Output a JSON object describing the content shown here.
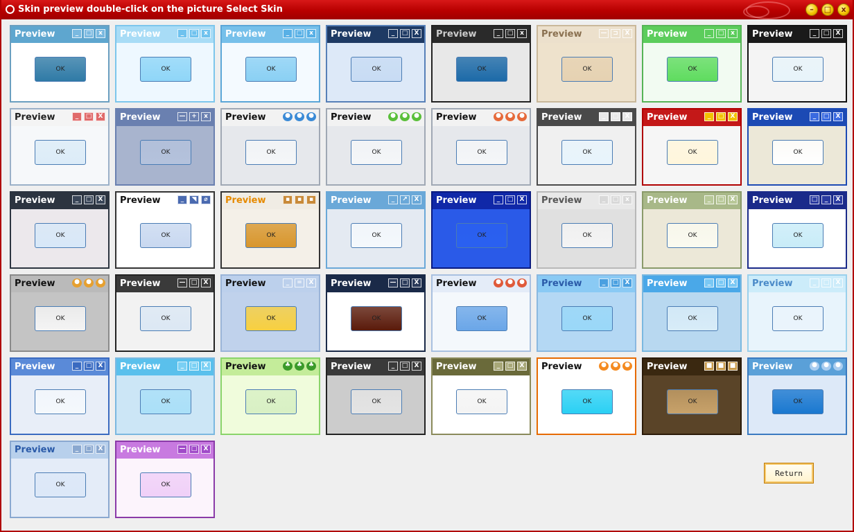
{
  "window": {
    "title": "Skin preview double-click on the picture Select Skin",
    "controls": [
      "minimize-icon",
      "maximize-icon",
      "close-icon"
    ],
    "accent": "#c00000"
  },
  "skins": [
    {
      "label": "Preview",
      "ok": "OK",
      "theme": {
        "bar": "#5ea6cf",
        "text": "#ffffff",
        "body": "#ffffff",
        "border": "#6a9fc0",
        "btn": "#2f7aa6",
        "ctl": "#7ab9e0",
        "ctls": [
          "_",
          "□",
          "x"
        ]
      }
    },
    {
      "label": "Preview",
      "ok": "OK",
      "theme": {
        "bar": "#a8dcf6",
        "text": "#ffffff",
        "body": "#eef8ff",
        "border": "#7cc6ec",
        "btn": "#8fd6f8",
        "ctl": "#6fc2ee",
        "ctls": [
          "_",
          "□",
          "x"
        ]
      }
    },
    {
      "label": "Preview",
      "ok": "OK",
      "theme": {
        "bar": "#76c0ea",
        "text": "#ffffff",
        "body": "#f4faff",
        "border": "#5aa6d8",
        "btn": "#8ad0f4",
        "ctl": "#58b0e6",
        "ctls": [
          "_",
          "□",
          "x"
        ]
      }
    },
    {
      "label": "Preview",
      "ok": "OK",
      "theme": {
        "bar": "#1e3a64",
        "text": "#ffffff",
        "body": "#dde9f8",
        "border": "#5780b8",
        "btn": "#c8dcf4",
        "ctl": "#1e3a64",
        "ctls": [
          "_",
          "□",
          "X"
        ]
      }
    },
    {
      "label": "Preview",
      "ok": "OK",
      "theme": {
        "bar": "#2a2a2a",
        "text": "#cccccc",
        "body": "#e8e8e8",
        "border": "#222222",
        "btn": "#1c6aa8",
        "ctl": "#2a2a2a",
        "ctls": [
          "_",
          "□",
          "x"
        ]
      }
    },
    {
      "label": "Preview",
      "ok": "OK",
      "theme": {
        "bar": "#ece0cc",
        "text": "#8a7050",
        "body": "#eee2cc",
        "border": "#c9b89a",
        "btn": "#e6d2b2",
        "ctl": "#ece0cc",
        "ctls": [
          "—",
          "⊐",
          "X"
        ]
      }
    },
    {
      "label": "Preview",
      "ok": "OK",
      "theme": {
        "bar": "#5ccd5c",
        "text": "#ffffff",
        "body": "#f2fbf2",
        "border": "#56b456",
        "btn": "#5fdc5f",
        "ctl": "#5ccd5c",
        "ctls": [
          "_",
          "□",
          "x"
        ]
      }
    },
    {
      "label": "Preview",
      "ok": "OK",
      "theme": {
        "bar": "#1a1a1a",
        "text": "#ffffff",
        "body": "#f4f4f4",
        "border": "#111111",
        "btn": "#e8f4fa",
        "ctl": "#1a1a1a",
        "ctls": [
          "_",
          "□",
          "X"
        ]
      }
    },
    {
      "label": "Preview",
      "ok": "OK",
      "theme": {
        "bar": "#f4f4f4",
        "text": "#222222",
        "body": "#f6f8fa",
        "border": "#9ab0c8",
        "btn": "#dcecf8",
        "ctl": "#e06a6a",
        "ctls": [
          "_",
          "□",
          "X"
        ]
      }
    },
    {
      "label": "Preview",
      "ok": "OK",
      "theme": {
        "bar": "#6a80b0",
        "text": "#ffffff",
        "body": "#a8b4ce",
        "border": "#6a80b0",
        "btn": "#b4c2dc",
        "ctl": "#6a80b0",
        "ctls": [
          "—",
          "+",
          "x"
        ]
      }
    },
    {
      "label": "Preview",
      "ok": "OK",
      "theme": {
        "bar": "#f2f2f2",
        "text": "#111111",
        "body": "#e6e8ec",
        "border": "#a0a8b4",
        "btn": "#f4f6f8",
        "ctl": "#3a8ad6",
        "ctls": [
          "●",
          "●",
          "●"
        ]
      }
    },
    {
      "label": "Preview",
      "ok": "OK",
      "theme": {
        "bar": "#f2f2f2",
        "text": "#111111",
        "body": "#e6e8ec",
        "border": "#a0a8b4",
        "btn": "#f4f6f8",
        "ctl": "#5abf3a",
        "ctls": [
          "●",
          "●",
          "●"
        ]
      }
    },
    {
      "label": "Preview",
      "ok": "OK",
      "theme": {
        "bar": "#f2f2f2",
        "text": "#111111",
        "body": "#e6e8ec",
        "border": "#a0a8b4",
        "btn": "#f4f6f8",
        "ctl": "#e66a3a",
        "ctls": [
          "●",
          "●",
          "●"
        ]
      }
    },
    {
      "label": "Preview",
      "ok": "OK",
      "theme": {
        "bar": "#4a4a4a",
        "text": "#ffffff",
        "body": "#f0f0f0",
        "border": "#4a4a4a",
        "btn": "#e8f4fc",
        "ctl": "#e8e8e8",
        "ctls": [
          "_",
          "□",
          "X"
        ]
      }
    },
    {
      "label": "Preview",
      "ok": "OK",
      "theme": {
        "bar": "#c41818",
        "text": "#ffffff",
        "body": "#f6f6f6",
        "border": "#b00000",
        "btn": "#fff6dc",
        "ctl": "#f2c200",
        "ctls": [
          "_",
          "□",
          "X"
        ]
      }
    },
    {
      "label": "Preview",
      "ok": "OK",
      "theme": {
        "bar": "#1c4ab4",
        "text": "#ffffff",
        "body": "#ece8d8",
        "border": "#1c4ab4",
        "btn": "#ffffff",
        "ctl": "#3a6ae0",
        "ctls": [
          "_",
          "□",
          "X"
        ]
      }
    },
    {
      "label": "Preview",
      "ok": "OK",
      "theme": {
        "bar": "#2c3440",
        "text": "#ffffff",
        "body": "#ece8ec",
        "border": "#2c3440",
        "btn": "#d8e8f8",
        "ctl": "#3a4658",
        "ctls": [
          "_",
          "□",
          "X"
        ]
      }
    },
    {
      "label": "Preview",
      "ok": "OK",
      "theme": {
        "bar": "#ffffff",
        "text": "#111111",
        "body": "#ffffff",
        "border": "#333333",
        "btn": "#c8d8f0",
        "ctl": "#4a6ab0",
        "ctls": [
          "_",
          "◥",
          "⌀"
        ]
      }
    },
    {
      "label": "Preview",
      "ok": "OK",
      "theme": {
        "bar": "#f0ece4",
        "text": "#e68a00",
        "body": "#f4f0e8",
        "border": "#333333",
        "btn": "#d8962c",
        "ctl": "#c88a3a",
        "ctls": [
          "▪",
          "▪",
          "▪"
        ]
      }
    },
    {
      "label": "Preview",
      "ok": "OK",
      "theme": {
        "bar": "#6aa8d8",
        "text": "#ffffff",
        "body": "#e4eaf2",
        "border": "#6aa8d8",
        "btn": "#f4f8fc",
        "ctl": "#6aa8d8",
        "ctls": [
          "_",
          "↗",
          "X"
        ]
      }
    },
    {
      "label": "Preview",
      "ok": "OK",
      "theme": {
        "bar": "#1028a8",
        "text": "#ffffff",
        "body": "#2a5ae8",
        "border": "#0a1a80",
        "btn": "#2a60f0",
        "ctl": "#1028a8",
        "ctls": [
          "_",
          "□",
          "X"
        ]
      }
    },
    {
      "label": "Preview",
      "ok": "OK",
      "theme": {
        "bar": "#e8e8e8",
        "text": "#555555",
        "body": "#e0e0e0",
        "border": "#b8b8b8",
        "btn": "#f4f4f4",
        "ctl": "#d8d8d8",
        "ctls": [
          "_",
          "□",
          "x"
        ]
      }
    },
    {
      "label": "Preview",
      "ok": "OK",
      "theme": {
        "bar": "#a8b888",
        "text": "#ffffff",
        "body": "#ece8d8",
        "border": "#8a9a6a",
        "btn": "#fafaf0",
        "ctl": "#b8c898",
        "ctls": [
          "_",
          "□",
          "X"
        ]
      }
    },
    {
      "label": "Preview",
      "ok": "OK",
      "theme": {
        "bar": "#1a2a8a",
        "text": "#ffffff",
        "body": "#ffffff",
        "border": "#1a2a8a",
        "btn": "#c8ecf8",
        "ctl": "#2a3aa0",
        "ctls": [
          "□",
          "_",
          "X"
        ]
      }
    },
    {
      "label": "Preview",
      "ok": "OK",
      "theme": {
        "bar": "#bababa",
        "text": "#111111",
        "body": "#c4c4c4",
        "border": "#8a8a8a",
        "btn": "#f4f4f4",
        "ctl": "#e6a030",
        "ctls": [
          "●",
          "●",
          "●"
        ]
      }
    },
    {
      "label": "Preview",
      "ok": "OK",
      "theme": {
        "bar": "#3a3a3a",
        "text": "#ffffff",
        "body": "#f2f2f2",
        "border": "#222222",
        "btn": "#dce8f4",
        "ctl": "#3a3a3a",
        "ctls": [
          "—",
          "□",
          "X"
        ]
      }
    },
    {
      "label": "Preview",
      "ok": "OK",
      "theme": {
        "bar": "#bcd0ec",
        "text": "#111111",
        "body": "#c0d2ec",
        "border": "#9ab4d8",
        "btn": "#f8d040",
        "ctl": "#bcd0ec",
        "ctls": [
          "_",
          "=",
          "X"
        ]
      }
    },
    {
      "label": "Preview",
      "ok": "OK",
      "theme": {
        "bar": "#1a2a48",
        "text": "#ffffff",
        "body": "#ffffff",
        "border": "#1a2a48",
        "btn": "#5a1a0a",
        "ctl": "#2a3a5a",
        "ctls": [
          "—",
          "□",
          "X"
        ]
      }
    },
    {
      "label": "Preview",
      "ok": "OK",
      "theme": {
        "bar": "#e4ecf8",
        "text": "#111111",
        "body": "#f4f8fc",
        "border": "#a8c0e0",
        "btn": "#6aa6e8",
        "ctl": "#e05a3a",
        "ctls": [
          "●",
          "●",
          "●"
        ]
      }
    },
    {
      "label": "Preview",
      "ok": "OK",
      "theme": {
        "bar": "#8acaf4",
        "text": "#2a5aa8",
        "body": "#b4d8f4",
        "border": "#8ab8e0",
        "btn": "#9ad8f8",
        "ctl": "#4aa0e0",
        "ctls": [
          "_",
          "□",
          "X"
        ]
      }
    },
    {
      "label": "Preview",
      "ok": "OK",
      "theme": {
        "bar": "#4aa8e8",
        "text": "#ffffff",
        "body": "#b8d8f0",
        "border": "#7ab8e0",
        "btn": "#d8ecf8",
        "ctl": "#7ac8f4",
        "ctls": [
          "_",
          "□",
          "X"
        ]
      }
    },
    {
      "label": "Preview",
      "ok": "OK",
      "theme": {
        "bar": "#ccecfa",
        "text": "#4a8ac8",
        "body": "#e8f4fc",
        "border": "#9ad0ec",
        "btn": "#eaf4fc",
        "ctl": "#ccecfa",
        "ctls": [
          "_",
          "□",
          "X"
        ]
      }
    },
    {
      "label": "Preview",
      "ok": "OK",
      "theme": {
        "bar": "#5a8ad8",
        "text": "#ffffff",
        "body": "#e8eef8",
        "border": "#3a6ac0",
        "btn": "#f4f8fc",
        "ctl": "#3a6ac0",
        "ctls": [
          "_",
          "□",
          "X"
        ]
      }
    },
    {
      "label": "Preview",
      "ok": "OK",
      "theme": {
        "bar": "#5ac0ec",
        "text": "#ffffff",
        "body": "#cce6f6",
        "border": "#7ab8e0",
        "btn": "#aae0f8",
        "ctl": "#7ad0f4",
        "ctls": [
          "_",
          "□",
          "X"
        ]
      }
    },
    {
      "label": "Preview",
      "ok": "OK",
      "theme": {
        "bar": "#c4ec9a",
        "text": "#111111",
        "body": "#f0fcdc",
        "border": "#8ad46a",
        "btn": "#d8f0c4",
        "ctl": "#3a9a2a",
        "ctls": [
          "♣",
          "♣",
          "♣"
        ]
      }
    },
    {
      "label": "Preview",
      "ok": "OK",
      "theme": {
        "bar": "#3a3a3a",
        "text": "#ffffff",
        "body": "#cccccc",
        "border": "#222222",
        "btn": "#e4e4e4",
        "ctl": "#3a3a3a",
        "ctls": [
          "_",
          "□",
          "X"
        ]
      }
    },
    {
      "label": "Preview",
      "ok": "OK",
      "theme": {
        "bar": "#6a6a3a",
        "text": "#ffffff",
        "body": "#ffffff",
        "border": "#8a8a5a",
        "btn": "#f4f4f4",
        "ctl": "#a8a878",
        "ctls": [
          "_",
          "□",
          "X"
        ]
      }
    },
    {
      "label": "Preview",
      "ok": "OK",
      "theme": {
        "bar": "#ffffff",
        "text": "#111111",
        "body": "#ffffff",
        "border": "#e66a00",
        "btn": "#2ad0f4",
        "ctl": "#f48a20",
        "ctls": [
          "●",
          "●",
          "●"
        ]
      }
    },
    {
      "label": "Preview",
      "ok": "OK",
      "theme": {
        "bar": "#3a2810",
        "text": "#ffffff",
        "body": "#5a4428",
        "border": "#2a1a08",
        "btn": "#c8a26a",
        "ctl": "#c89a4a",
        "ctls": [
          "■",
          "■",
          "■"
        ]
      }
    },
    {
      "label": "Preview",
      "ok": "OK",
      "theme": {
        "bar": "#5aa0d8",
        "text": "#ffffff",
        "body": "#dde9f8",
        "border": "#3a7ac0",
        "btn": "#1a78d0",
        "ctl": "#aacdf0",
        "ctls": [
          "●",
          "●",
          "●"
        ]
      }
    },
    {
      "label": "Preview",
      "ok": "OK",
      "theme": {
        "bar": "#b8d0ec",
        "text": "#2a5aa8",
        "body": "#e4ecf8",
        "border": "#8aa8d0",
        "btn": "#dce8f8",
        "ctl": "#8aa8d0",
        "ctls": [
          "_",
          "□",
          "X"
        ]
      }
    },
    {
      "label": "Preview",
      "ok": "OK",
      "theme": {
        "bar": "#c87ae0",
        "text": "#ffffff",
        "body": "#fcf4fc",
        "border": "#8a3aa8",
        "btn": "#f0d0f8",
        "ctl": "#a04ac8",
        "ctls": [
          "—",
          "□",
          "X"
        ]
      }
    }
  ],
  "return_button": "Return"
}
